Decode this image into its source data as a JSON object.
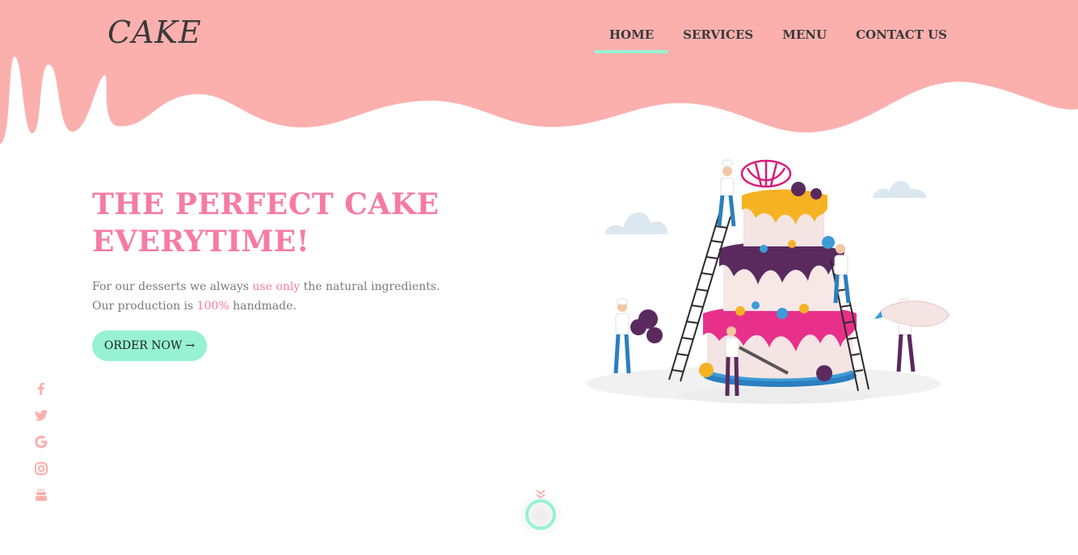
{
  "header": {
    "logo": "CAKE",
    "nav": [
      {
        "label": "HOME",
        "active": true
      },
      {
        "label": "SERVICES",
        "active": false
      },
      {
        "label": "MENU",
        "active": false
      },
      {
        "label": "CONTACT US",
        "active": false
      }
    ]
  },
  "hero": {
    "headline_line1": "THE PERFECT CAKE",
    "headline_line2": "EVERYTIME!",
    "desc_part1": "For our desserts we always ",
    "desc_highlight1": "use only",
    "desc_part2": " the natural ingredients.",
    "desc_part3": "Our production is ",
    "desc_highlight2": "100%",
    "desc_part4": " handmade.",
    "order_label": "ORDER NOW",
    "order_arrow": "→"
  },
  "social": [
    "facebook-icon",
    "twitter-icon",
    "google-icon",
    "instagram-icon",
    "cake-icon"
  ],
  "colors": {
    "drip": "#fbb0ae",
    "accent_pink": "#f77aa5",
    "accent_mint": "#96f2d2",
    "text_dark": "#3a3a3a",
    "text_muted": "#7a7a7a"
  }
}
